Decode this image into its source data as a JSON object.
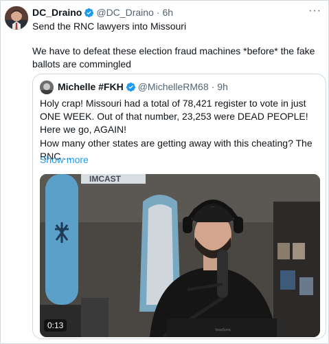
{
  "tweet": {
    "author_name": "DC_Draino",
    "author_handle": "@DC_Draino",
    "separator": "·",
    "time": "6h",
    "more_glyph": "···",
    "text_line1": "Send the RNC lawyers into Missouri",
    "text_line2": "We have to defeat these election fraud machines *before* the fake ballots are commingled"
  },
  "quote": {
    "author_name": "Michelle #FKH",
    "author_handle": "@MichelleRM68",
    "separator": "·",
    "time": "9h",
    "text_paragraph1": "Holy crap! Missouri had a total of 78,421 register to vote in just ONE WEEK. Out of that number, 23,253 were DEAD PEOPLE! Here we go, AGAIN!",
    "text_paragraph2": "How many other states are getting away with this cheating? The RNC ...",
    "show_more": "Show more",
    "video_duration": "0:13",
    "video_sign_text": "IMCAST",
    "video_monitor_text": "ViewSonic"
  },
  "colors": {
    "verified_blue": "#1d9bf0",
    "link_blue": "#1d9bf0",
    "secondary_text": "#536471",
    "border": "#cfd9de"
  },
  "icons": {
    "verified": "verified-badge-icon",
    "more": "more-options-icon"
  }
}
